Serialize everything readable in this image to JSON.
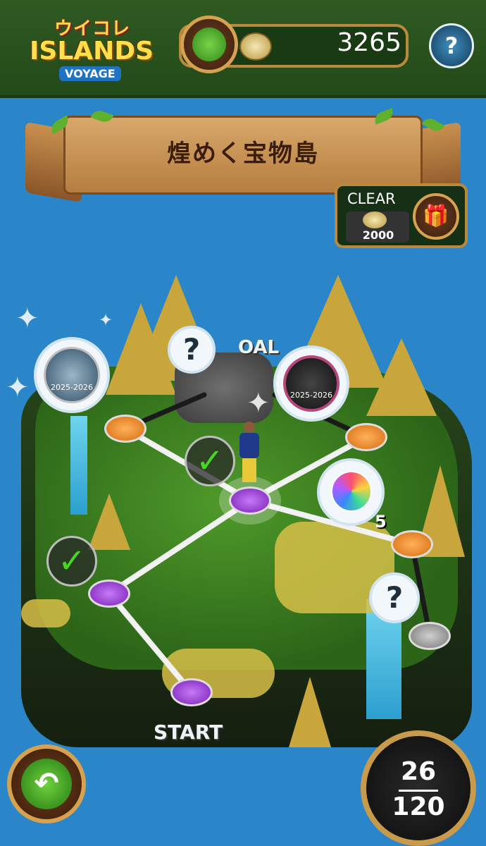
{
  "header": {
    "logo_jp": "ウイコレ",
    "logo_title": "ISLANDS",
    "logo_sub": "VOYAGE",
    "coins": "3265",
    "help_symbol": "?"
  },
  "banner": {
    "title": "煌めく宝物島"
  },
  "clear_reward": {
    "label": "CLEAR",
    "amount": "2000",
    "gift_icon": "gift-icon"
  },
  "map": {
    "start_label": "START",
    "goal_label": "OAL",
    "unknown_symbol": "?",
    "check_symbol": "✓",
    "ball_count": "5",
    "badges": [
      {
        "text": "2025-2026"
      },
      {
        "text": "2025-2026"
      }
    ]
  },
  "counter": {
    "current": "26",
    "total": "120"
  },
  "back_button": {
    "symbol": "↶"
  },
  "colors": {
    "header_bg": "#2f5a22",
    "sea": "#2a86c9",
    "gold": "#d6a250"
  }
}
